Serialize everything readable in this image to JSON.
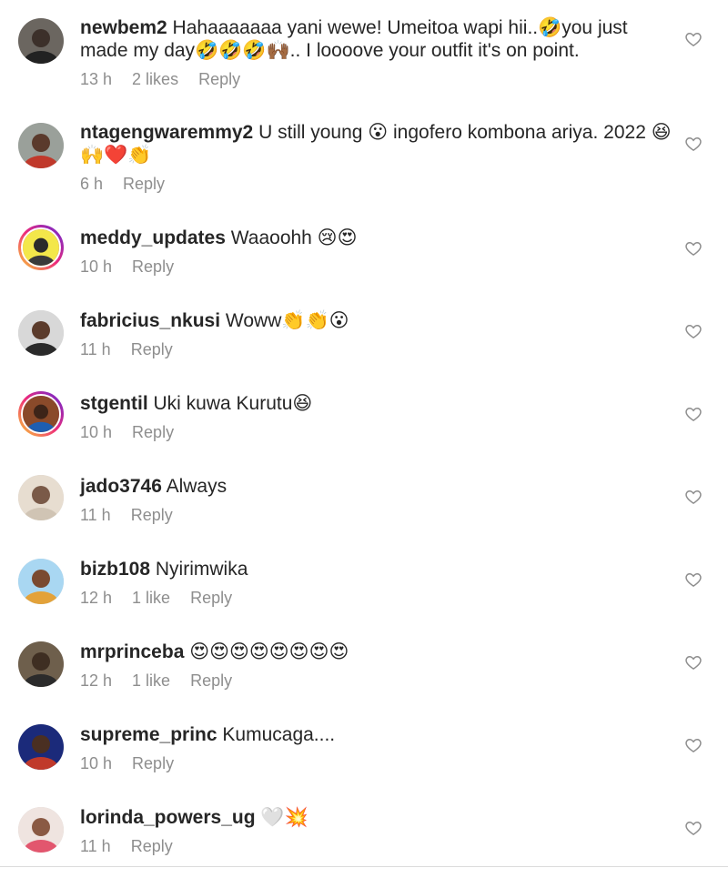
{
  "comments": [
    {
      "username": "newbem2",
      "text": "Hahaaaaaaa yani wewe! Umeitoa wapi hii..🤣you just made my day🤣🤣🤣🙌🏾.. I loooove your outfit it's on point.",
      "time": "13 h",
      "likes": "2 likes",
      "reply": "Reply",
      "avatar": "avatar-dark",
      "story_ring": false
    },
    {
      "username": "ntagengwaremmy2",
      "text": "U still young 😮 ingofero kombona ariya. 2022 😆🙌❤️👏",
      "time": "6 h",
      "likes": "",
      "reply": "Reply",
      "avatar": "avatar-red",
      "story_ring": false
    },
    {
      "username": "meddy_updates",
      "text": "Waaoohh 😢😍",
      "time": "10 h",
      "likes": "",
      "reply": "Reply",
      "avatar": "avatar-yellow",
      "story_ring": true
    },
    {
      "username": "fabricius_nkusi",
      "text": "Woww👏👏😮",
      "time": "11 h",
      "likes": "",
      "reply": "Reply",
      "avatar": "avatar-grey",
      "story_ring": false
    },
    {
      "username": "stgentil",
      "text": "Uki kuwa Kurutu😆",
      "time": "10 h",
      "likes": "",
      "reply": "Reply",
      "avatar": "avatar-blue",
      "story_ring": true
    },
    {
      "username": "jado3746",
      "text": "Always",
      "time": "11 h",
      "likes": "",
      "reply": "Reply",
      "avatar": "avatar-beige",
      "story_ring": false
    },
    {
      "username": "bizb108",
      "text": "Nyirimwika",
      "time": "12 h",
      "likes": "1 like",
      "reply": "Reply",
      "avatar": "avatar-sky",
      "story_ring": false
    },
    {
      "username": "mrprinceba",
      "text": "😍😍😍😍😍😍😍😍",
      "time": "12 h",
      "likes": "1 like",
      "reply": "Reply",
      "avatar": "avatar-brown",
      "story_ring": false
    },
    {
      "username": "supreme_princ",
      "text": "Kumucaga....",
      "time": "10 h",
      "likes": "",
      "reply": "Reply",
      "avatar": "avatar-navy",
      "story_ring": false
    },
    {
      "username": "lorinda_powers_ug",
      "text": "🤍💥",
      "time": "11 h",
      "likes": "",
      "reply": "Reply",
      "avatar": "avatar-pink",
      "story_ring": false
    }
  ],
  "colors": {
    "text": "#262626",
    "meta": "#8e8e8e",
    "divider": "#dbdbdb"
  },
  "icons": {
    "like": "heart-outline-icon"
  }
}
